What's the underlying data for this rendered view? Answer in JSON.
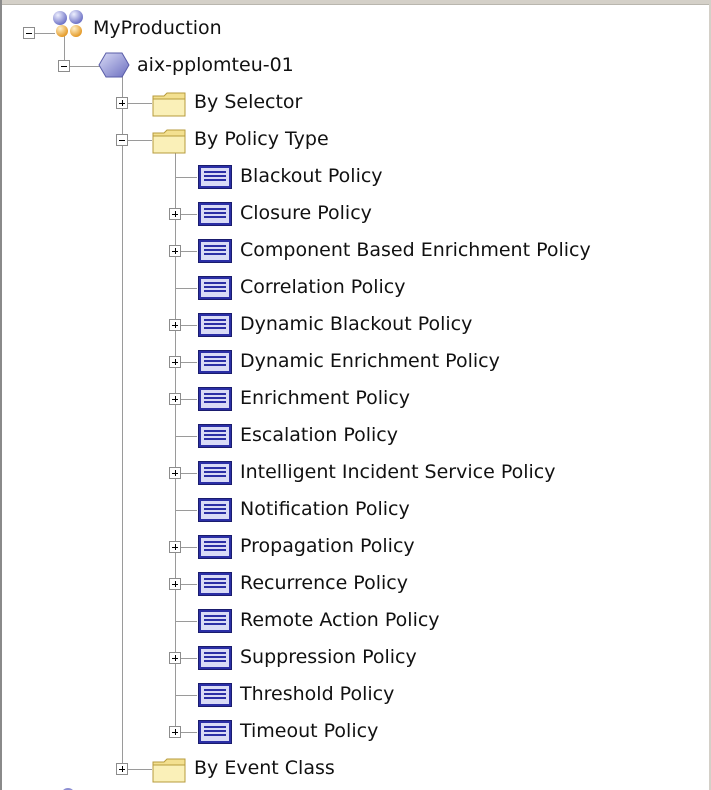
{
  "tree": {
    "root": {
      "label": "MyProduction"
    },
    "server": {
      "label": "aix-pplomteu-01"
    },
    "by_selector": {
      "label": "By Selector"
    },
    "by_policy_type": {
      "label": "By Policy Type"
    },
    "policies": [
      {
        "label": "Blackout Policy",
        "expandable": false
      },
      {
        "label": "Closure Policy",
        "expandable": true
      },
      {
        "label": "Component Based Enrichment Policy",
        "expandable": true
      },
      {
        "label": "Correlation Policy",
        "expandable": false
      },
      {
        "label": "Dynamic Blackout Policy",
        "expandable": true
      },
      {
        "label": "Dynamic Enrichment Policy",
        "expandable": true
      },
      {
        "label": "Enrichment Policy",
        "expandable": true
      },
      {
        "label": "Escalation Policy",
        "expandable": false
      },
      {
        "label": "Intelligent Incident Service Policy",
        "expandable": true
      },
      {
        "label": "Notification Policy",
        "expandable": false
      },
      {
        "label": "Propagation Policy",
        "expandable": true
      },
      {
        "label": "Recurrence Policy",
        "expandable": true
      },
      {
        "label": "Remote Action Policy",
        "expandable": false
      },
      {
        "label": "Suppression Policy",
        "expandable": true
      },
      {
        "label": "Threshold Policy",
        "expandable": false
      },
      {
        "label": "Timeout Policy",
        "expandable": true
      }
    ],
    "by_event_class": {
      "label": "By Event Class"
    }
  },
  "colors": {
    "tree_line": "#9a9a9a",
    "folder_fill": "#f7e9a0",
    "folder_edge": "#b79b3c",
    "policy_blue": "#2b2fa6",
    "server_purple": "#8d8fd2"
  },
  "icons": {
    "root": "network-cluster-icon",
    "server": "server-hexagon-icon",
    "folder": "folder-icon",
    "policy": "policy-document-icon"
  }
}
